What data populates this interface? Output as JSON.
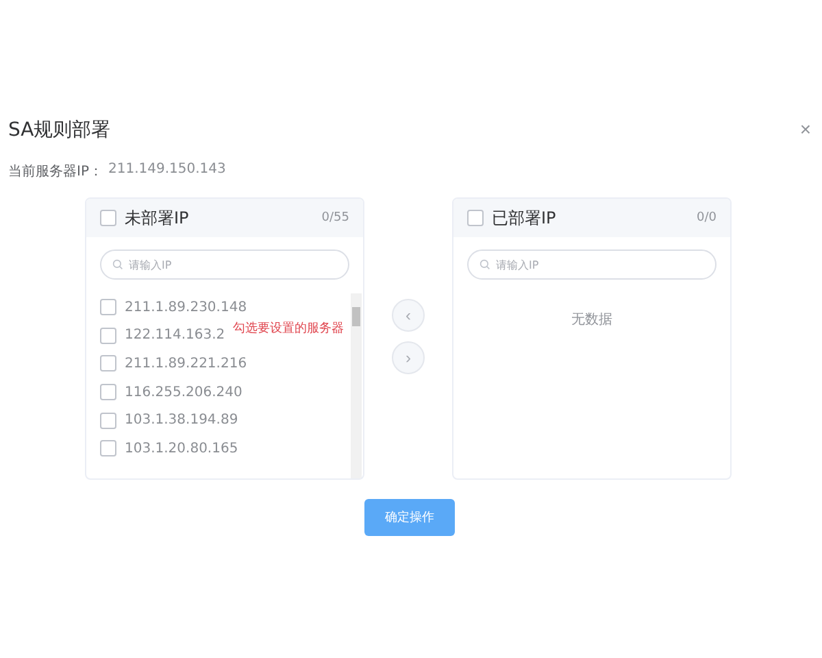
{
  "dialog": {
    "title": "SA规则部署",
    "close": "×",
    "server_label": "当前服务器IP：",
    "server_ip": "211.149.150.143"
  },
  "source": {
    "checked": false,
    "title": "未部署IP",
    "count": "0/55",
    "search": {
      "placeholder": "请输入IP"
    },
    "items": [
      {
        "label": "211.1.89.230.148",
        "checked": false
      },
      {
        "label": "122.114.163.2",
        "checked": false
      },
      {
        "label": "211.1.89.221.216",
        "checked": false
      },
      {
        "label": "116.255.206.240",
        "checked": false
      },
      {
        "label": "103.1.38.194.89",
        "checked": false
      },
      {
        "label": "103.1.20.80.165",
        "checked": false
      }
    ],
    "hint": "勾选要设置的服务器"
  },
  "arrows": [
    {
      "glyph": "‹",
      "disabled": true
    },
    {
      "glyph": "›",
      "disabled": true
    }
  ],
  "target": {
    "checked": false,
    "title": "已部署IP",
    "count": "0/0",
    "search": {
      "placeholder": "请输入IP"
    },
    "empty": "无数据"
  },
  "confirm": "确定操作"
}
